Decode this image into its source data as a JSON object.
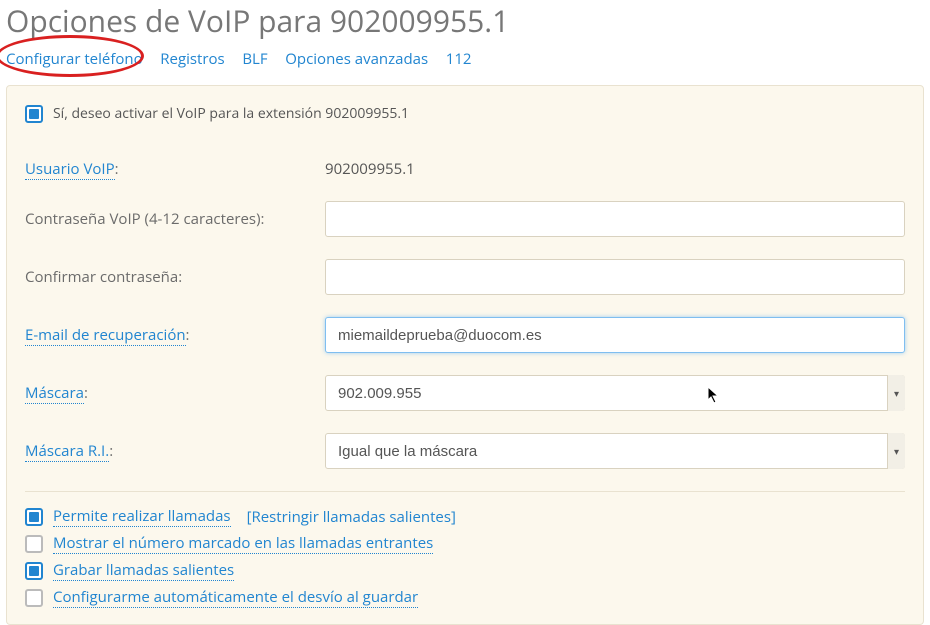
{
  "header": {
    "title": "Opciones de VoIP para 902009955.1"
  },
  "tabs": {
    "configure": "Configurar teléfono",
    "logs": "Registros",
    "blf": "BLF",
    "advanced": "Opciones avanzadas",
    "sos": "112"
  },
  "activation": {
    "label": "Sí, deseo activar el VoIP para la extensión 902009955.1",
    "checked": true
  },
  "fields": {
    "voip_user": {
      "label": "Usuario VoIP",
      "value": "902009955.1"
    },
    "voip_password": {
      "label": "Contraseña VoIP (4-12 caracteres):",
      "value": ""
    },
    "confirm_password": {
      "label": "Confirmar contraseña:",
      "value": ""
    },
    "recovery_email": {
      "label": "E-mail de recuperación",
      "value": "miemaildeprueba@duocom.es"
    },
    "mask": {
      "label": "Máscara",
      "value": "902.009.955"
    },
    "mask_ri": {
      "label": "Máscara R.I.",
      "value": "Igual que la máscara"
    }
  },
  "options": {
    "allow_calls": {
      "label": "Permite realizar llamadas",
      "checked": true,
      "restrict_link": "[Restringir llamadas salientes]"
    },
    "show_dialed": {
      "label": "Mostrar el número marcado en las llamadas entrantes",
      "checked": false
    },
    "record_out": {
      "label": "Grabar llamadas salientes",
      "checked": true
    },
    "auto_forward": {
      "label": "Configurarme automáticamente el desvío al guardar",
      "checked": false
    }
  }
}
